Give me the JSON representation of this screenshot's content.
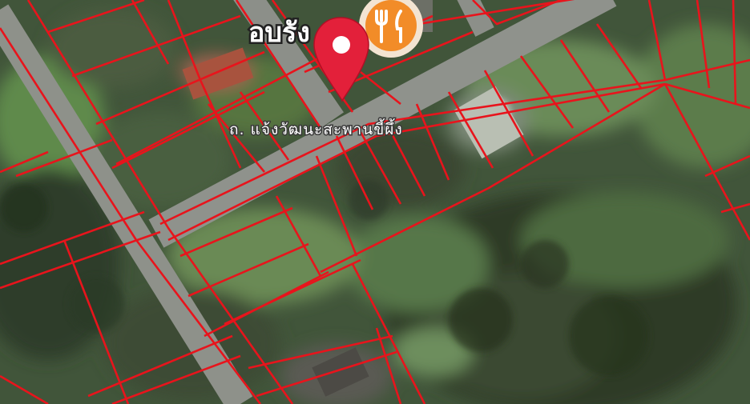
{
  "map": {
    "view": "satellite",
    "overlay": "land parcel boundaries",
    "parcel_color": "#e8141c",
    "pin_color": "#e3203a",
    "poi_color": "#f28c28"
  },
  "labels": {
    "place_name": "อบรัง",
    "road_name": "ถ. แจ้งวัฒนะสะพานขี้ผึ้ง"
  },
  "markers": {
    "location_pin": {
      "icon": "map-pin-icon"
    },
    "restaurant_poi": {
      "icon": "fork-knife-icon"
    }
  }
}
